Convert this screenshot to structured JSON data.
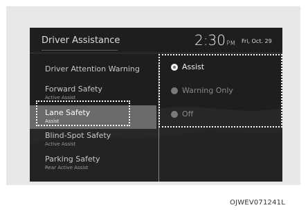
{
  "header": {
    "title": "Driver Assistance",
    "time": "2:30",
    "ampm": "PM",
    "date": "Fri, Oct. 29"
  },
  "menu": {
    "items": [
      {
        "label": "Driver Attention Warning",
        "sub": ""
      },
      {
        "label": "Forward Safety",
        "sub": "Active Assist"
      },
      {
        "label": "Lane Safety",
        "sub": "Assist",
        "selected": true
      },
      {
        "label": "Blind-Spot Safety",
        "sub": "Active Assist"
      },
      {
        "label": "Parking Safety",
        "sub": "Rear Active Assist"
      }
    ]
  },
  "options": {
    "items": [
      {
        "label": "Assist",
        "checked": true
      },
      {
        "label": "Warning Only",
        "checked": false
      },
      {
        "label": "Off",
        "checked": false
      }
    ]
  },
  "figure_code": "OJWEV071241L",
  "colors": {
    "screen_bg": "#1e1e1e",
    "selected_bg": "#6a6a6a",
    "highlight_border": "#ffffff"
  }
}
